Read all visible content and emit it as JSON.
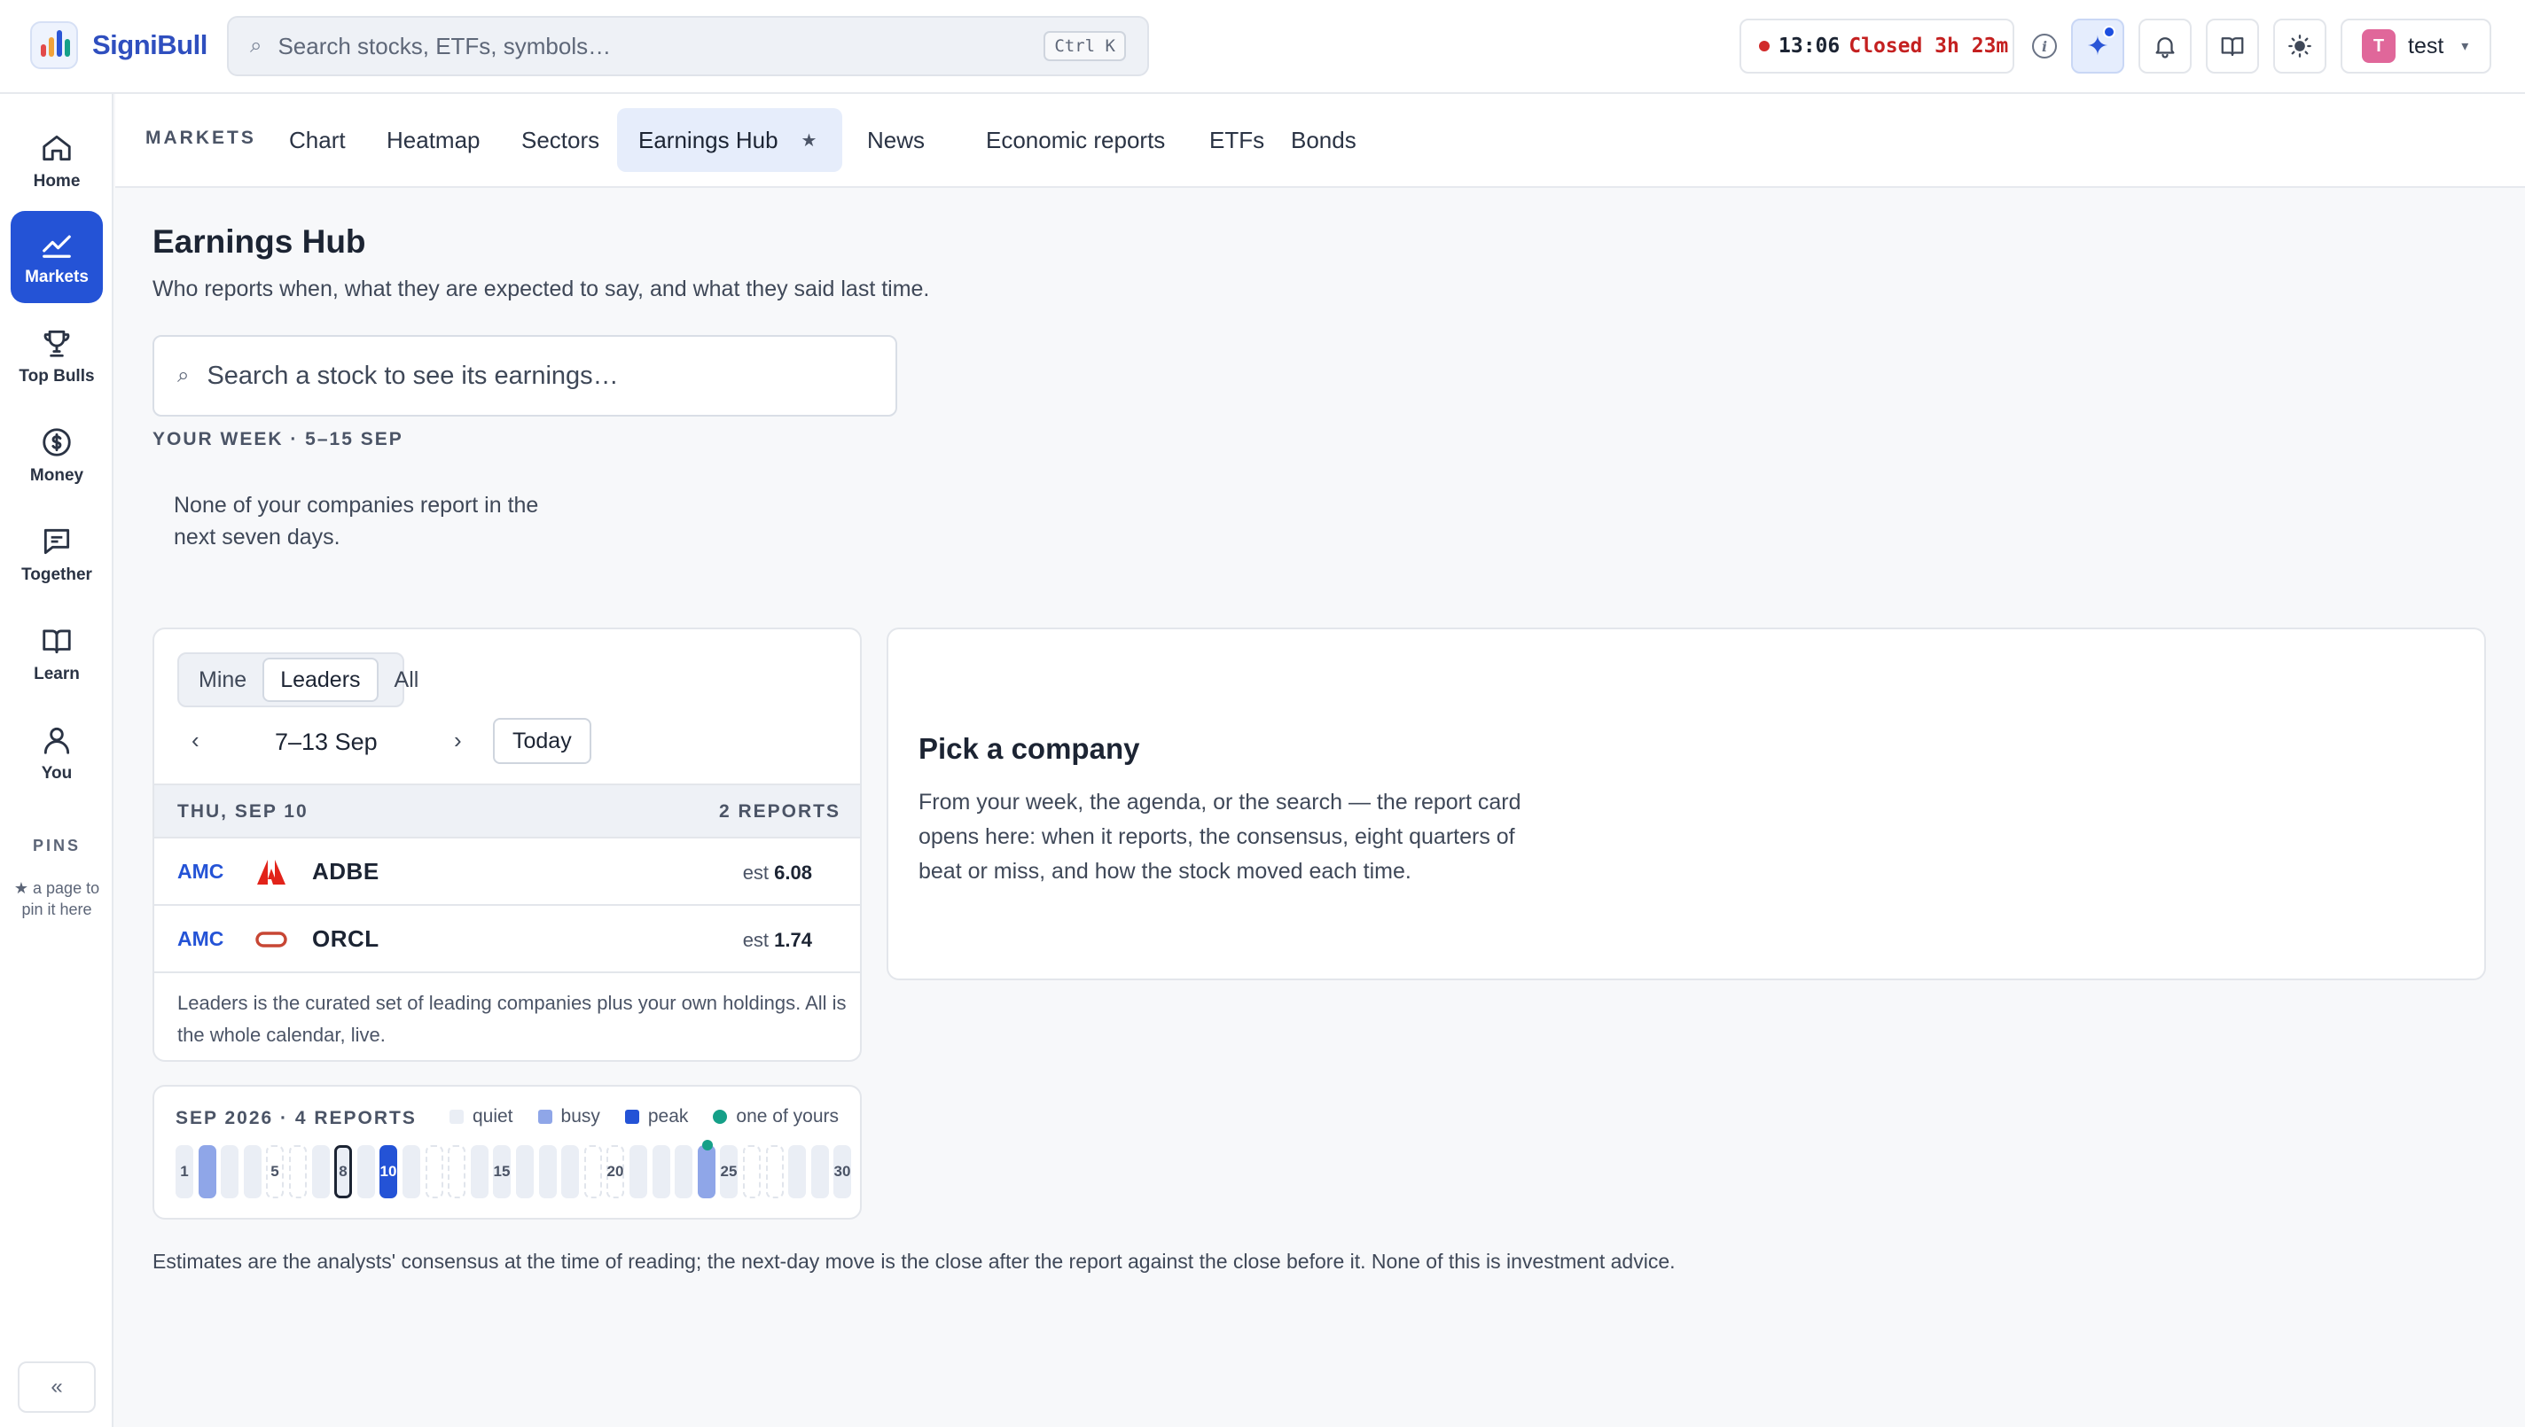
{
  "app": {
    "brand": "SigniBull",
    "colors": {
      "accent": "#2453d6",
      "closed": "#c42020",
      "mine": "#15a088"
    }
  },
  "search": {
    "placeholder": "Search stocks, ETFs, symbols…",
    "shortcut": "Ctrl K"
  },
  "market_status": {
    "time": "13:06",
    "status": "Closed 3h 23m"
  },
  "header_icons": [
    "info-icon",
    "ai-sparkle-icon",
    "bell-icon",
    "book-icon",
    "sun-icon"
  ],
  "user": {
    "initial": "T",
    "name": "test"
  },
  "sidebar": {
    "items": [
      {
        "label": "Home",
        "icon": "home-icon"
      },
      {
        "label": "Markets",
        "icon": "chart-line-icon",
        "active": true
      },
      {
        "label": "Top Bulls",
        "icon": "trophy-icon"
      },
      {
        "label": "Money",
        "icon": "coin-icon"
      },
      {
        "label": "Together",
        "icon": "chat-icon"
      },
      {
        "label": "Learn",
        "icon": "book-icon"
      },
      {
        "label": "You",
        "icon": "user-icon"
      }
    ],
    "pins_title": "PINS",
    "pins_hint": "★ a page to pin it here",
    "collapse": "«"
  },
  "subnav": {
    "section": "MARKETS",
    "tabs": [
      "Chart",
      "Heatmap",
      "Sectors",
      "Earnings Hub",
      "News",
      "Economic reports",
      "ETFs",
      "Bonds"
    ],
    "active_tab": "Earnings Hub",
    "star": "★"
  },
  "page": {
    "title": "Earnings Hub",
    "subtitle": "Who reports when, what they are expected to say, and what they said last time.",
    "stock_search_placeholder": "Search a stock to see its earnings…",
    "week_label": "YOUR WEEK · 5–15 SEP",
    "week_empty": "None of your companies report in the next seven days."
  },
  "agenda": {
    "filters": [
      "Mine",
      "Leaders",
      "All"
    ],
    "active_filter": "Leaders",
    "prev": "‹",
    "range": "7–13 Sep",
    "next": "›",
    "today": "Today",
    "day": {
      "label": "THU, SEP 10",
      "count": "2 REPORTS"
    },
    "rows": [
      {
        "time": "AMC",
        "symbol": "ADBE",
        "est_label": "est",
        "est": "6.08",
        "logo": "adobe-logo"
      },
      {
        "time": "AMC",
        "symbol": "ORCL",
        "est_label": "est",
        "est": "1.74",
        "logo": "oracle-logo"
      }
    ],
    "note": "Leaders is the curated set of leading companies plus your own holdings. All is the whole calendar, live."
  },
  "month": {
    "title": "SEP 2026 · 4 REPORTS",
    "legend": [
      "quiet",
      "busy",
      "peak",
      "one of yours"
    ],
    "days": [
      {
        "d": "1",
        "level": "quiet",
        "show": true
      },
      {
        "d": "2",
        "level": "busy"
      },
      {
        "d": "3",
        "level": "quiet"
      },
      {
        "d": "4",
        "level": "quiet"
      },
      {
        "d": "5",
        "level": "empty",
        "show": true
      },
      {
        "d": "6",
        "level": "empty"
      },
      {
        "d": "7",
        "level": "quiet"
      },
      {
        "d": "8",
        "level": "quiet",
        "show": true,
        "today": true
      },
      {
        "d": "9",
        "level": "quiet"
      },
      {
        "d": "10",
        "level": "peak",
        "show": true
      },
      {
        "d": "11",
        "level": "quiet"
      },
      {
        "d": "12",
        "level": "empty"
      },
      {
        "d": "13",
        "level": "empty"
      },
      {
        "d": "14",
        "level": "quiet"
      },
      {
        "d": "15",
        "level": "quiet",
        "show": true
      },
      {
        "d": "16",
        "level": "quiet"
      },
      {
        "d": "17",
        "level": "quiet"
      },
      {
        "d": "18",
        "level": "quiet"
      },
      {
        "d": "19",
        "level": "empty"
      },
      {
        "d": "20",
        "level": "empty",
        "show": true
      },
      {
        "d": "21",
        "level": "quiet"
      },
      {
        "d": "22",
        "level": "quiet"
      },
      {
        "d": "23",
        "level": "quiet"
      },
      {
        "d": "24",
        "level": "busy",
        "mine": true
      },
      {
        "d": "25",
        "level": "quiet",
        "show": true
      },
      {
        "d": "26",
        "level": "empty"
      },
      {
        "d": "27",
        "level": "empty"
      },
      {
        "d": "28",
        "level": "quiet"
      },
      {
        "d": "29",
        "level": "quiet"
      },
      {
        "d": "30",
        "level": "quiet",
        "show": true
      }
    ]
  },
  "pick": {
    "title": "Pick a company",
    "text": "From your week, the agenda, or the search — the report card opens here: when it reports, the consensus, eight quarters of beat or miss, and how the stock moved each time."
  },
  "disclaimer": "Estimates are the analysts' consensus at the time of reading; the next-day move is the close after the report against the close before it. None of this is investment advice."
}
